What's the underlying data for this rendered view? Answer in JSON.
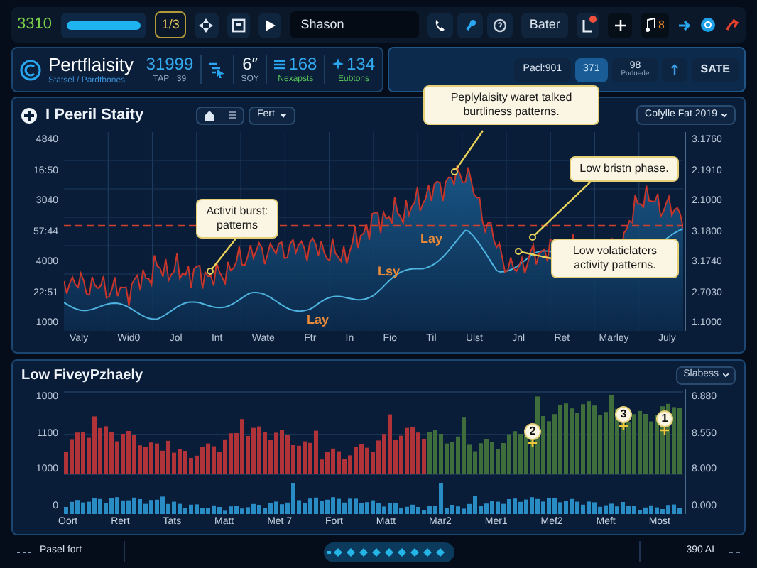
{
  "top_bar": {
    "counter": "3310",
    "progress": {
      "level": 1.0
    },
    "page_badge": "1/3",
    "search": {
      "value": "Shason"
    },
    "button": "Bater",
    "music_badge": "8",
    "book_alert": true
  },
  "header": {
    "app_name": "Pertflaisity",
    "subtitle": "Statsel / Pardtbones",
    "stats": [
      {
        "kind": "primary",
        "value": "31999",
        "label": "TAP · 39"
      },
      {
        "kind": "cursor"
      },
      {
        "kind": "plain",
        "value": "6″",
        "label": "SOY"
      },
      {
        "kind": "list",
        "value": "168",
        "label": "Nexapsts"
      },
      {
        "kind": "trend",
        "value": "134",
        "label": "Eubtons"
      }
    ],
    "controls": [
      {
        "kind": "text",
        "label": "Pacl:901",
        "selected": false
      },
      {
        "kind": "text",
        "label": "371",
        "selected": true
      },
      {
        "kind": "stacked",
        "label": "98",
        "sublabel": "Poduede",
        "selected": false
      },
      {
        "kind": "arrow",
        "selected": false
      },
      {
        "kind": "strong",
        "label": "SATE",
        "selected": false
      }
    ]
  },
  "main_chart": {
    "title": "I Peeril Staity",
    "filter": "Fert",
    "range": "Cofylle Fat 2019",
    "left_ticks": [
      "4840",
      "16:50",
      "3040",
      "57:44",
      "4000",
      "22:51",
      "1000"
    ],
    "right_ticks": [
      "3.1760",
      "2.1910",
      "2.1000",
      "3.1800",
      "3.1740",
      "2.7030",
      "1.1000"
    ],
    "x_labels": [
      "Valy",
      "Wid0",
      "Jol",
      "Int",
      "Wate",
      "Ftr",
      "In",
      "Fio",
      "Til",
      "Ulst",
      "Jnl",
      "Ret",
      "Marley",
      "July"
    ],
    "series_labels": [
      "Lay",
      "Lsy",
      "Lay"
    ],
    "callouts": [
      {
        "text": "Activit burst: patterns"
      },
      {
        "text": "Peplylaisity waret talked burtliness patterns."
      },
      {
        "text": "Low bristn phase."
      },
      {
        "text": "Low volaticlaters activity patterns."
      }
    ]
  },
  "volume_chart": {
    "title": "Low FiveyPzhaely",
    "filter": "Slabess",
    "left_ticks": [
      "1000",
      "1100",
      "1000",
      "0"
    ],
    "right_ticks": [
      "6.880",
      "8.550",
      "8.000",
      "0.000"
    ],
    "x_labels": [
      "Oort",
      "Rert",
      "Tats",
      "Matt",
      "Met 7",
      "Fort",
      "Matt",
      "Mar2",
      "Mer1",
      "Mef2",
      "Meft",
      "Most"
    ],
    "markers": [
      {
        "label": "2"
      },
      {
        "label": "3"
      },
      {
        "label": "1"
      }
    ]
  },
  "footer": {
    "left": "Pasel fort",
    "right": "390 AL"
  }
}
